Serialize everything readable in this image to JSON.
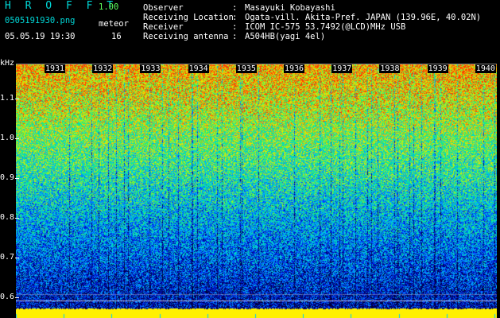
{
  "app": {
    "title": "H R O F F T",
    "version": "1.00"
  },
  "file": {
    "name": "0505191930.png",
    "datetime": "05.05.19 19:30"
  },
  "mode": {
    "label": "meteor",
    "count": "16"
  },
  "info": [
    {
      "key": "Observer",
      "value": "Masayuki Kobayashi"
    },
    {
      "key": "Receiving Location",
      "value": "Ogata-vill. Akita-Pref. JAPAN (139.96E, 40.02N)"
    },
    {
      "key": "Receiver",
      "value": "ICOM IC-575 53.7492(@LCD)MHz USB"
    },
    {
      "key": "Receiving antenna",
      "value": "A504HB(yagi 4el)"
    }
  ],
  "yaxis": {
    "unit": "kHz",
    "ticks": [
      "1.1",
      "1.0",
      "0.9",
      "0.8",
      "0.7",
      "0.6"
    ]
  },
  "xaxis": {
    "ticks": [
      "1931",
      "1932",
      "1933",
      "1934",
      "1935",
      "1936",
      "1937",
      "1938",
      "1939",
      "1940"
    ]
  },
  "colors": {
    "label_cyan": "#00d8d8",
    "label_green": "#5cff5c",
    "baseline_yellow": "#ffff00"
  }
}
